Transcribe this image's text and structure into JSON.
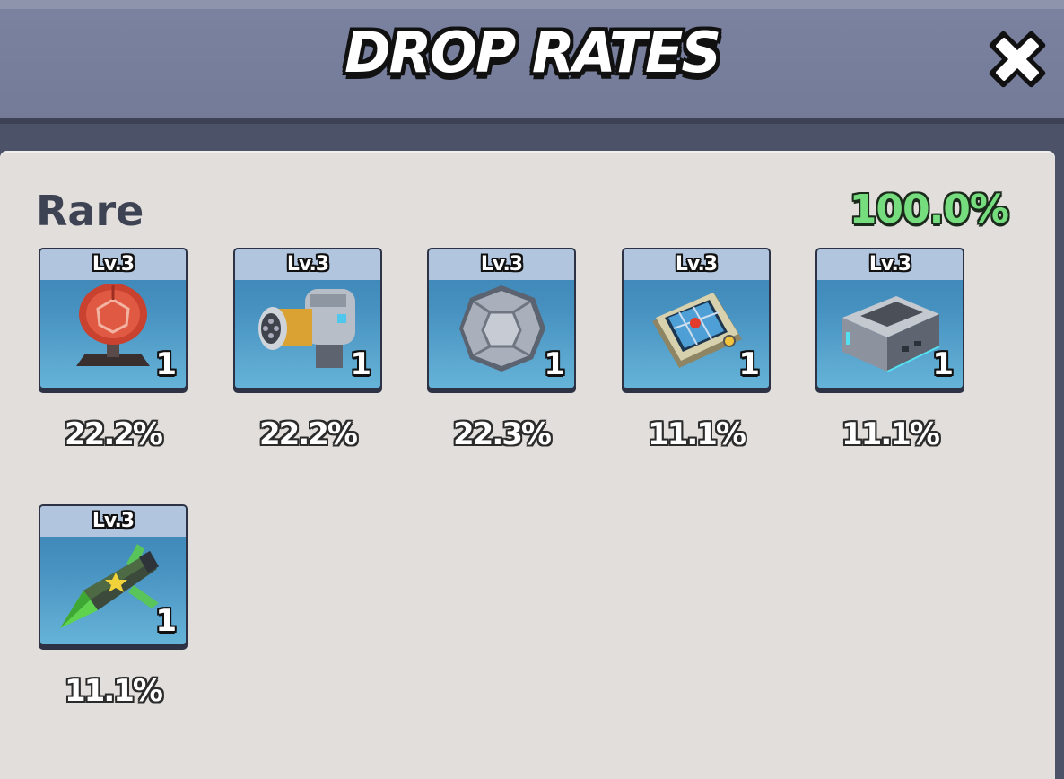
{
  "header": {
    "title": "DROP RATES"
  },
  "section": {
    "rarity": "Rare",
    "total": "100.0%"
  },
  "items": [
    {
      "icon": "radar-dish-icon",
      "level": "Lv.3",
      "quantity": "1",
      "rate": "22.2%"
    },
    {
      "icon": "gatling-cannon-icon",
      "level": "Lv.3",
      "quantity": "1",
      "rate": "22.2%"
    },
    {
      "icon": "armor-plate-icon",
      "level": "Lv.3",
      "quantity": "1",
      "rate": "22.3%"
    },
    {
      "icon": "radar-screen-icon",
      "level": "Lv.3",
      "quantity": "1",
      "rate": "11.1%"
    },
    {
      "icon": "device-box-icon",
      "level": "Lv.3",
      "quantity": "1",
      "rate": "11.1%"
    },
    {
      "icon": "missile-icon",
      "level": "Lv.3",
      "quantity": "1",
      "rate": "11.1%"
    }
  ],
  "colors": {
    "header_bg": "#7a82a0",
    "panel_bg": "#e2dedb",
    "card_bg": "#4792c1",
    "level_bar": "#b2c5de",
    "total_green": "#76dd7f"
  }
}
